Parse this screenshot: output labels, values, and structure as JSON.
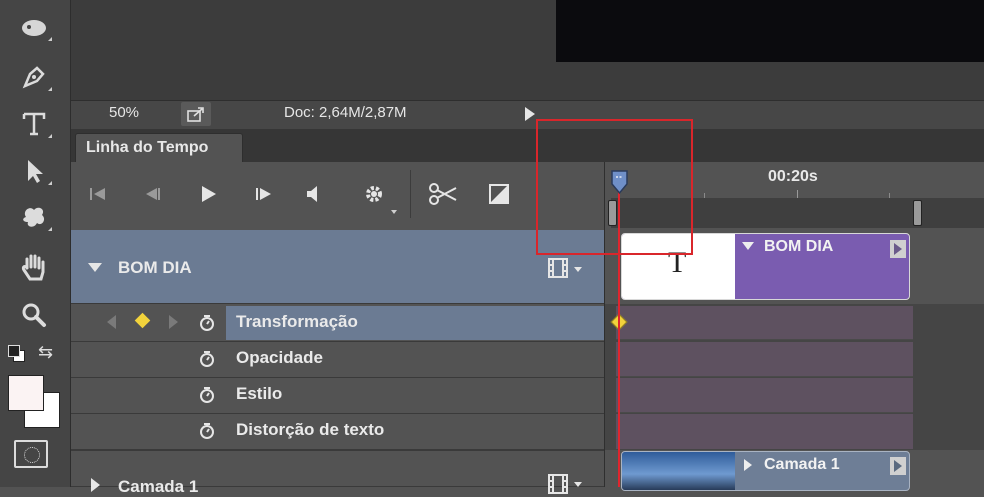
{
  "status": {
    "zoom": "50%",
    "doc": "Doc: 2,64M/2,87M"
  },
  "panel": {
    "tab": "Linha do Tempo"
  },
  "ruler": {
    "time_label": "00:20s"
  },
  "layers": [
    {
      "name": "BOM DIA",
      "clip_label": "BOM DIA",
      "thumb_text": "T"
    },
    {
      "name": "Camada 1",
      "clip_label": "Camada 1"
    }
  ],
  "properties": [
    "Transformação",
    "Opacidade",
    "Estilo",
    "Distorção de texto"
  ],
  "colors": {
    "selected_row": "#6b7b93",
    "text_clip": "#7a5cb0",
    "track": "#5e5160",
    "playhead": "#e0252e",
    "highlight_box": "#d9262b",
    "keyframe": "#f2d33c"
  }
}
